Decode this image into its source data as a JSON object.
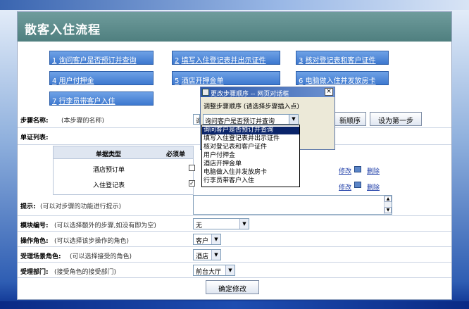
{
  "page": {
    "title": "散客入住流程"
  },
  "steps": [
    {
      "num": "1",
      "label": "询问客户是否预订并查询"
    },
    {
      "num": "2",
      "label": "填写入住登记表并出示证件"
    },
    {
      "num": "3",
      "label": "核对登记表和客户证件"
    },
    {
      "num": "4",
      "label": "用户付押金"
    },
    {
      "num": "5",
      "label": "酒店开押金单"
    },
    {
      "num": "6",
      "label": "电脑做入住并发放房卡"
    },
    {
      "num": "7",
      "label": "行李员带客户入住"
    }
  ],
  "form": {
    "step_name": {
      "label": "步骤名称:",
      "hint": "(本步骤的名称)",
      "value": "询问"
    },
    "doc_list": {
      "label": "单证列表:"
    },
    "table": {
      "headers": [
        "单据类型",
        "必须单"
      ],
      "rows": [
        {
          "type": "酒店预订单",
          "required": false,
          "edit": "修改",
          "delete": "删除"
        },
        {
          "type": "入住登记表",
          "required": true,
          "edit": "修改",
          "delete": "删除"
        }
      ]
    },
    "tip": {
      "label": "提示:",
      "hint": "(可以对步骤的功能进行提示)"
    },
    "module": {
      "label": "模块编号:",
      "hint": "(可以选择额外的步骤,如没有即为空)",
      "value": "无"
    },
    "role": {
      "label": "操作角色:",
      "hint": "(可以选择该步操作的角色)",
      "value": "客户"
    },
    "scene_role": {
      "label": "受理场景角色:",
      "hint": "(可以选择接受的角色)",
      "value": "酒店"
    },
    "dept": {
      "label": "受理部门:",
      "hint": "(接受角色的接受部门)",
      "value": "前台大厅"
    },
    "buttons": {
      "new_order": "新顺序",
      "set_first": "设为第一步",
      "confirm": "确定修改"
    }
  },
  "dialog": {
    "title": "更改步骤顺序 -- 网页对话框",
    "close": "×",
    "prompt": "调整步骤顺序 (请选择步骤插入点)",
    "selected": "询问客户是否预订并查询",
    "options": [
      "询问客户是否预订并查询",
      "填写入住登记表并出示证件",
      "核对登记表和客户证件",
      "用户付押金",
      "酒店开押金单",
      "电脑做入住并发放房卡",
      "行李员带客户入住"
    ]
  },
  "icons": {
    "dropdown": "▼",
    "scroll_up": "▲",
    "scroll_down": "▼",
    "checked": "✓"
  },
  "colors": {
    "title_bar": "#5f8f8f",
    "step_button": "#4a84d6",
    "selection": "#0a246a"
  }
}
